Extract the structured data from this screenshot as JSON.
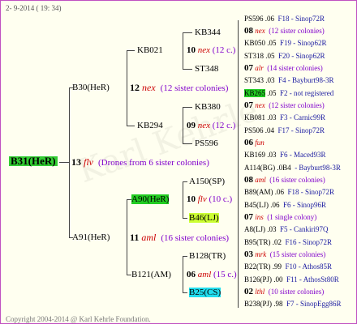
{
  "header": {
    "datetime": "2-  9-2014 ( 19: 34)"
  },
  "footer": {
    "copyright": "Copyright 2004-2014 @ Karl Kehrle Foundation."
  },
  "root": {
    "name": "B31(HeR)",
    "year": "13",
    "race": "flv",
    "desc": "(Drones from 6 sister colonies)"
  },
  "b30": {
    "name": "B30(HeR)",
    "year": "12",
    "race": "nex",
    "desc": "(12 sister colonies)"
  },
  "a91": {
    "name": "A91(HeR)",
    "year": "11",
    "race": "aml",
    "desc": "(16 sister colonies)"
  },
  "kb021": {
    "name": "KB021",
    "year": "10",
    "race": "nex",
    "desc": "(12 c.)"
  },
  "kb294": {
    "name": "KB294",
    "year": "09",
    "race": "nex",
    "desc": "(12 c.)"
  },
  "a90": {
    "name": "A90(HeR)",
    "year": "10",
    "race": "flv",
    "desc": "(10 c.)"
  },
  "b121": {
    "name": "B121(AM)",
    "year": "06",
    "race": "aml",
    "desc": "(15 c.)"
  },
  "g3": [
    {
      "name": "KB344"
    },
    {
      "name": "ST348"
    },
    {
      "name": "KB380"
    },
    {
      "name": "PS596"
    },
    {
      "name": "A150(SP)"
    },
    {
      "name": "B46(LJ)"
    },
    {
      "name": "B128(TR)"
    },
    {
      "name": "B25(CS)"
    }
  ],
  "g4": [
    {
      "l1n": "PS596",
      "l1y": ".06",
      "l1r": "F18 - Sinop72R",
      "yr": "08",
      "race": "nex",
      "desc": "(12 sister colonies)",
      "l3n": "KB050",
      "l3y": ".05",
      "l3r": "F19 - Sinop62R"
    },
    {
      "l1n": "ST318",
      "l1y": ".05",
      "l1r": "F20 - Sinop62R",
      "yr": "07",
      "race": "alr",
      "desc": "(14 sister colonies)",
      "l3n": "ST343",
      "l3y": ".03",
      "l3r": "F4 - Bayburt98-3R"
    },
    {
      "l1n": "KB265",
      "l1y": ".05",
      "l1r": "F2 - not registered",
      "yr": "07",
      "race": "nex",
      "desc": "(12 sister colonies)",
      "l3n": "KB081",
      "l3y": ".03",
      "l3r": "F3 - Carnic99R"
    },
    {
      "l1n": "PS506",
      "l1y": ".04",
      "l1r": "F17 - Sinop72R",
      "yr": "06",
      "race": "fun",
      "desc": "",
      "l3n": "KB169",
      "l3y": ".03",
      "l3r": "F6 - Maced93R"
    },
    {
      "l1n": "A114(BG)",
      "l1y": ".0B4",
      "l1r": "- Bayburt98-3R",
      "yr": "08",
      "race": "aml",
      "desc": "(16 sister colonies)",
      "l3n": "B89(AM)",
      "l3y": ".06",
      "l3r": "F18 - Sinop72R"
    },
    {
      "l1n": "B45(LJ)",
      "l1y": ".06",
      "l1r": "F6 - Sinop96R",
      "yr": "07",
      "race": "ins",
      "desc": "(1 single colony)",
      "l3n": "A8(LJ)",
      "l3y": ".03",
      "l3r": "F5 - Cankiri97Q"
    },
    {
      "l1n": "B95(TR)",
      "l1y": ".02",
      "l1r": "F16 - Sinop72R",
      "yr": "03",
      "race": "mrk",
      "desc": "(15 sister colonies)",
      "l3n": "B22(TR)",
      "l3y": ".99",
      "l3r": "F10 - Athos85R"
    },
    {
      "l1n": "B126(PJ)",
      "l1y": ".00",
      "l1r": "F11 - AthosSt80R",
      "yr": "02",
      "race": "lthl",
      "desc": "(10 sister colonies)",
      "l3n": "B238(PJ)",
      "l3y": ".98",
      "l3r": "F7 - SinopEgg86R"
    }
  ]
}
